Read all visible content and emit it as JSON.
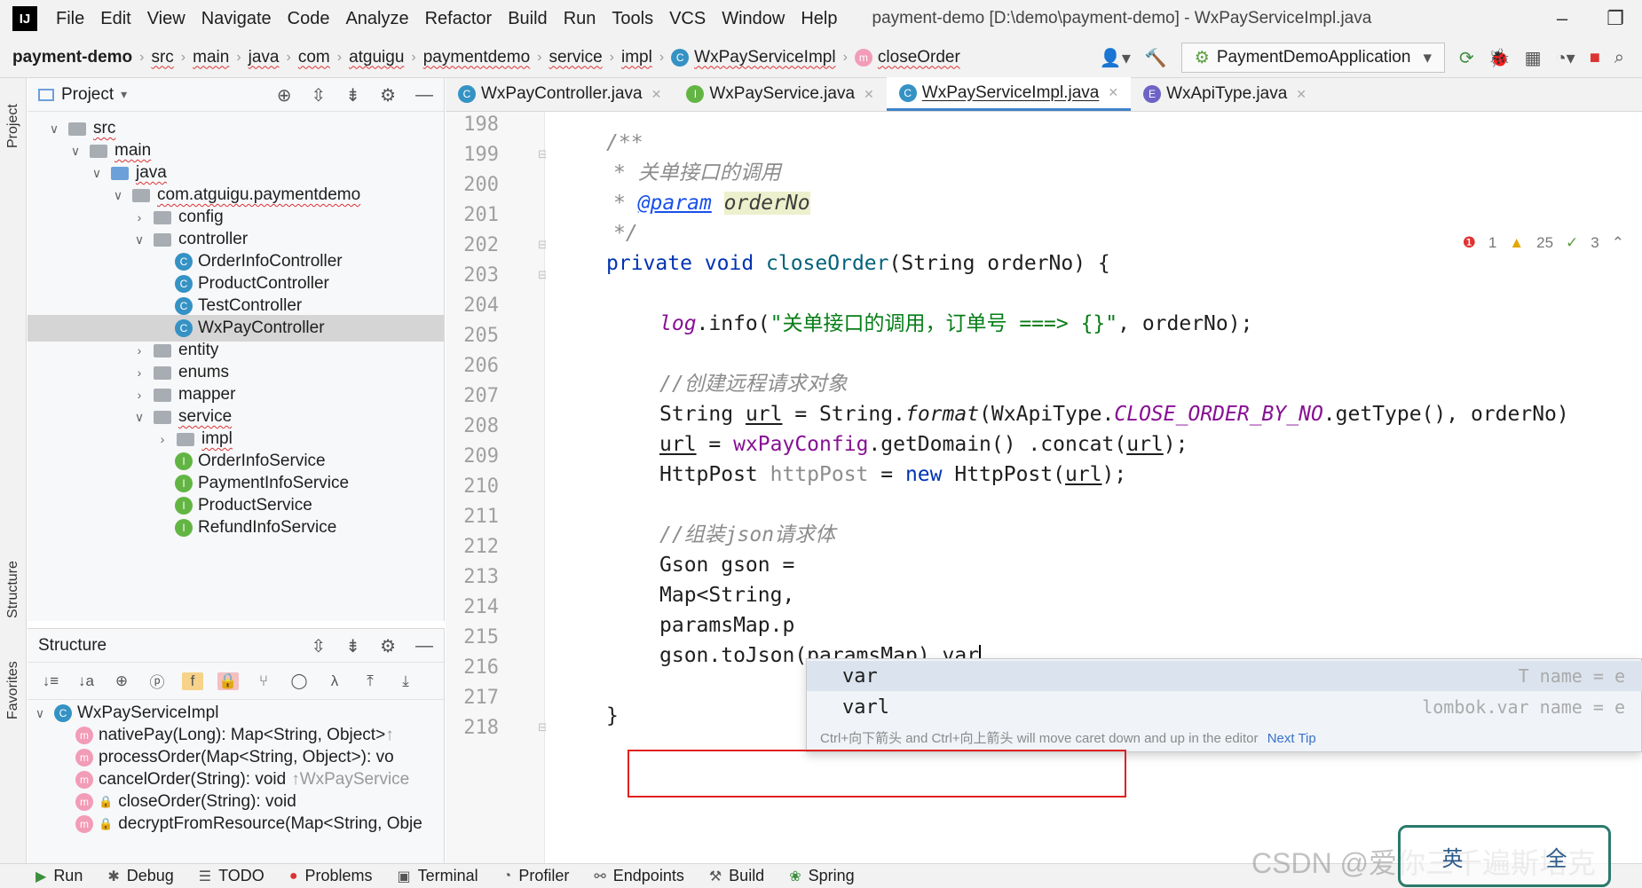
{
  "app": {
    "logo": "IJ",
    "menu": [
      "File",
      "Edit",
      "View",
      "Navigate",
      "Code",
      "Analyze",
      "Refactor",
      "Build",
      "Run",
      "Tools",
      "VCS",
      "Window",
      "Help"
    ],
    "window_title": "payment-demo [D:\\demo\\payment-demo] - WxPayServiceImpl.java"
  },
  "breadcrumb": [
    "payment-demo",
    "src",
    "main",
    "java",
    "com",
    "atguigu",
    "paymentdemo",
    "service",
    "impl",
    "WxPayServiceImpl",
    "closeOrder"
  ],
  "run_config": "PaymentDemoApplication",
  "project_panel": {
    "title": "Project",
    "tree": [
      {
        "label": "src",
        "kind": "folder",
        "expanded": true
      },
      {
        "label": "main",
        "kind": "folder",
        "expanded": true
      },
      {
        "label": "java",
        "kind": "folder-blue",
        "expanded": true
      },
      {
        "label": "com.atguigu.paymentdemo",
        "kind": "package",
        "expanded": true
      },
      {
        "label": "config",
        "kind": "package",
        "expanded": false
      },
      {
        "label": "controller",
        "kind": "package",
        "expanded": true
      },
      {
        "label": "OrderInfoController",
        "kind": "class"
      },
      {
        "label": "ProductController",
        "kind": "class"
      },
      {
        "label": "TestController",
        "kind": "class"
      },
      {
        "label": "WxPayController",
        "kind": "class",
        "selected": true
      },
      {
        "label": "entity",
        "kind": "package",
        "expanded": false
      },
      {
        "label": "enums",
        "kind": "package",
        "expanded": false
      },
      {
        "label": "mapper",
        "kind": "package",
        "expanded": false
      },
      {
        "label": "service",
        "kind": "package",
        "expanded": true
      },
      {
        "label": "impl",
        "kind": "package",
        "expanded": false
      },
      {
        "label": "OrderInfoService",
        "kind": "interface"
      },
      {
        "label": "PaymentInfoService",
        "kind": "interface"
      },
      {
        "label": "ProductService",
        "kind": "interface"
      },
      {
        "label": "RefundInfoService",
        "kind": "interface"
      }
    ]
  },
  "structure_panel": {
    "title": "Structure",
    "root": "WxPayServiceImpl",
    "members": [
      {
        "label": "nativePay(Long): Map<String, Object>",
        "suffix": "↑"
      },
      {
        "label": "processOrder(Map<String, Object>): vo",
        "suffix": ""
      },
      {
        "label": "cancelOrder(String): void",
        "suffix": "↑WxPayService"
      },
      {
        "label": "closeOrder(String): void",
        "suffix": ""
      },
      {
        "label": "decryptFromResource(Map<String, Obje",
        "suffix": ""
      }
    ]
  },
  "left_stripe": {
    "project": "Project",
    "structure": "Structure",
    "favorites": "Favorites"
  },
  "editor": {
    "tabs": [
      {
        "label": "WxPayController.java",
        "badge": "C",
        "active": false
      },
      {
        "label": "WxPayService.java",
        "badge": "I",
        "active": false
      },
      {
        "label": "WxPayServiceImpl.java",
        "badge": "C",
        "active": true
      },
      {
        "label": "WxApiType.java",
        "badge": "E",
        "active": false
      }
    ],
    "line_numbers": [
      "198",
      "199",
      "200",
      "201",
      "202",
      "203",
      "204",
      "205",
      "206",
      "207",
      "208",
      "209",
      "210",
      "211",
      "212",
      "213",
      "214",
      "215",
      "216",
      "217",
      "218"
    ],
    "inspections": {
      "errors": "1",
      "warnings": "25",
      "typos": "3"
    },
    "code": {
      "l199": "/**",
      "l200": "* 关单接口的调用",
      "l201_tag": "@param",
      "l201_name": "orderNo",
      "l202": "*/",
      "l203_a": "private void ",
      "l203_b": "closeOrder",
      "l203_c": "(String orderNo) {",
      "l205_a": "log",
      "l205_b": ".info(",
      "l205_str": "\"关单接口的调用，订单号 ===> {}\"",
      "l205_c": ", orderNo);",
      "l207": "//创建远程请求对象",
      "l208_a": "String ",
      "l208_b": "url",
      "l208_c": " = String.",
      "l208_d": "format",
      "l208_e": "(WxApiType.",
      "l208_f": "CLOSE_ORDER_BY_NO",
      "l208_g": ".getType(), orderNo)",
      "l209_a": "url",
      "l209_b": " = ",
      "l209_c": "wxPayConfig",
      "l209_d": ".getDomain() .concat(",
      "l209_e": "url",
      "l209_f": ");",
      "l210_a": "HttpPost ",
      "l210_b": "httpPost",
      "l210_c": " = ",
      "l210_d": "new",
      "l210_e": " HttpPost(",
      "l210_f": "url",
      "l210_g": ");",
      "l212": "//组装json请求体",
      "l213": "Gson gson = ",
      "l214": "Map<String,",
      "l215": "paramsMap.p",
      "l216": "gson.toJson(paramsMap).var",
      "l218": "}"
    },
    "completion": {
      "items": [
        {
          "label": "var",
          "hint": "T name = e"
        },
        {
          "label": "varl",
          "hint": "lombok.var name = e"
        }
      ],
      "tip": "Ctrl+向下箭头 and Ctrl+向上箭头 will move caret down and up in the editor",
      "tip_link": "Next Tip"
    }
  },
  "bottom_bar": [
    {
      "label": "Run",
      "icon": "run-icon"
    },
    {
      "label": "Debug",
      "icon": "debug-icon"
    },
    {
      "label": "TODO",
      "icon": "todo-icon"
    },
    {
      "label": "Problems",
      "icon": "problems-icon"
    },
    {
      "label": "Terminal",
      "icon": "terminal-icon"
    },
    {
      "label": "Profiler",
      "icon": "profiler-icon"
    },
    {
      "label": "Endpoints",
      "icon": "endpoints-icon"
    },
    {
      "label": "Build",
      "icon": "build-icon"
    },
    {
      "label": "Spring",
      "icon": "spring-icon"
    }
  ],
  "watermark": "CSDN @爱你三千遍斯塔克",
  "ime": {
    "a": "英",
    "b": "全"
  },
  "colors": {
    "accent": "#4083c9",
    "highlight_box": "#e02020",
    "keyword": "#0033b3",
    "string": "#067d17",
    "comment": "#8c8c8c"
  }
}
